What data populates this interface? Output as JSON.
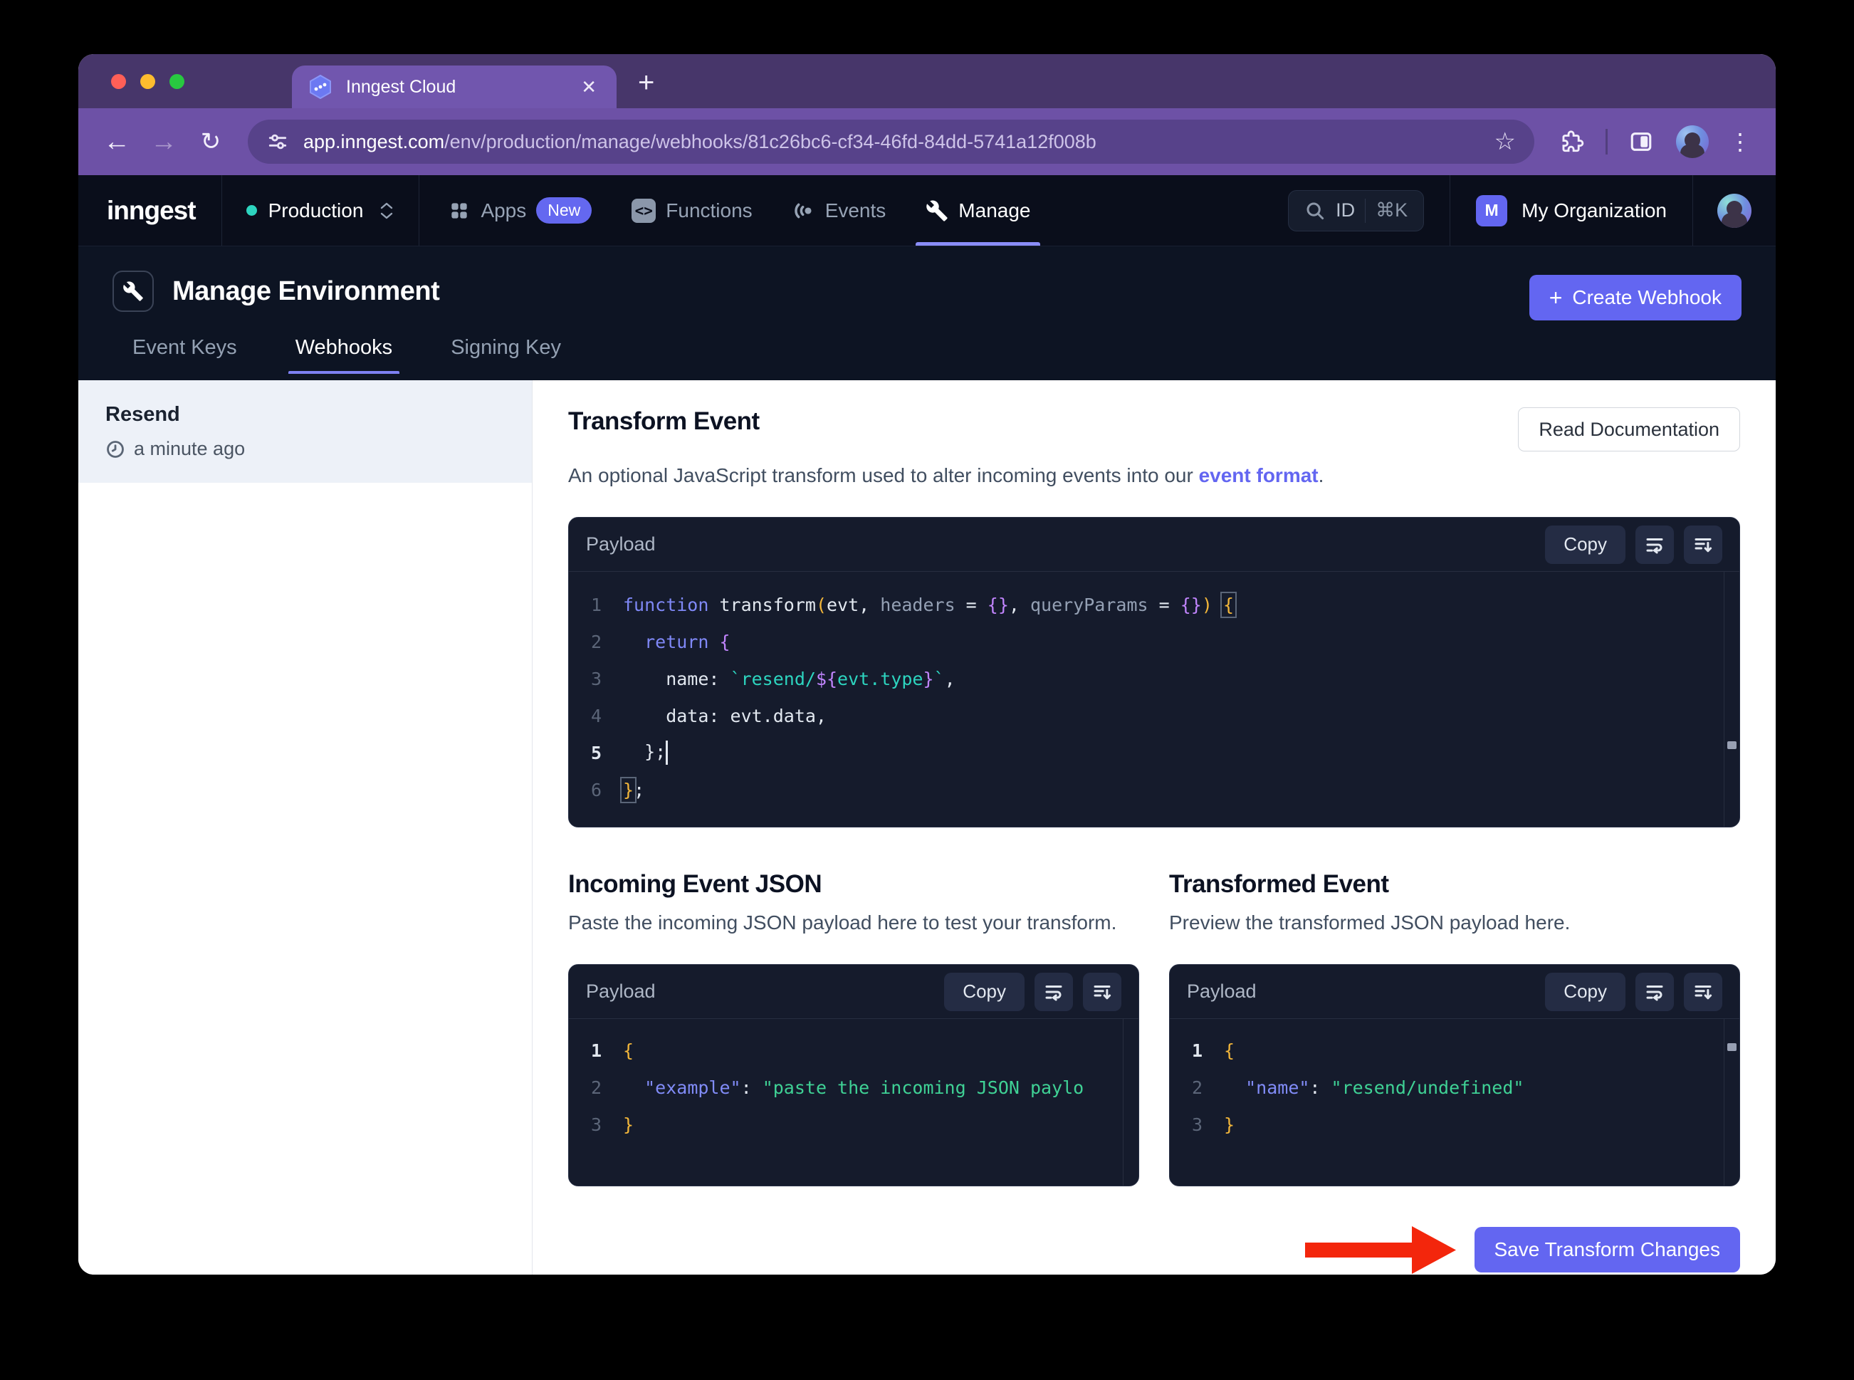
{
  "browser": {
    "tab_title": "Inngest Cloud",
    "close_glyph": "✕",
    "new_tab_glyph": "+",
    "back_glyph": "←",
    "forward_glyph": "→",
    "reload_glyph": "↻",
    "star_glyph": "☆",
    "menu_glyph": "⋮",
    "url_host": "app.inngest.com",
    "url_path": "/env/production/manage/webhooks/81c26bc6-cf34-46fd-84dd-5741a12f008b"
  },
  "nav": {
    "logo": "inngest",
    "env_name": "Production",
    "items": [
      {
        "label": "Apps",
        "badge": "New"
      },
      {
        "label": "Functions"
      },
      {
        "label": "Events"
      },
      {
        "label": "Manage"
      }
    ],
    "functions_icon_glyph": "<>",
    "search": {
      "id_label": "ID",
      "shortcut": "⌘K"
    },
    "org": {
      "initial": "M",
      "name": "My Organization"
    }
  },
  "manage_header": {
    "title": "Manage Environment",
    "create_plus": "+",
    "create_label": "Create Webhook",
    "tabs": [
      {
        "label": "Event Keys",
        "active": false
      },
      {
        "label": "Webhooks",
        "active": true
      },
      {
        "label": "Signing Key",
        "active": false
      }
    ]
  },
  "sidebar": {
    "items": [
      {
        "name": "Resend",
        "time": "a minute ago",
        "selected": true
      }
    ]
  },
  "transform": {
    "title": "Transform Event",
    "read_docs_label": "Read Documentation",
    "description_prefix": "An optional JavaScript transform used to alter incoming events into our ",
    "link_text": "event format",
    "description_suffix": "."
  },
  "editor": {
    "label": "Payload",
    "copy_label": "Copy",
    "lines": [
      {
        "n": "1",
        "active": false,
        "segs": [
          {
            "c": "kw",
            "t": "function"
          },
          {
            "c": "plain",
            "t": " transform"
          },
          {
            "c": "paren",
            "t": "("
          },
          {
            "c": "plain",
            "t": "evt, "
          },
          {
            "c": "param",
            "t": "headers"
          },
          {
            "c": "plain",
            "t": " = "
          },
          {
            "c": "brace",
            "t": "{}"
          },
          {
            "c": "plain",
            "t": ", "
          },
          {
            "c": "param",
            "t": "queryParams"
          },
          {
            "c": "plain",
            "t": " = "
          },
          {
            "c": "brace",
            "t": "{}"
          },
          {
            "c": "paren",
            "t": ")"
          },
          {
            "c": "plain",
            "t": " "
          },
          {
            "c": "boxed",
            "t": "{"
          }
        ]
      },
      {
        "n": "2",
        "active": false,
        "segs": [
          {
            "c": "plain",
            "t": "  "
          },
          {
            "c": "kw",
            "t": "return"
          },
          {
            "c": "plain",
            "t": " "
          },
          {
            "c": "brace",
            "t": "{"
          }
        ]
      },
      {
        "n": "3",
        "active": false,
        "segs": [
          {
            "c": "plain",
            "t": "    name: "
          },
          {
            "c": "str",
            "t": "`resend/"
          },
          {
            "c": "brace",
            "t": "${"
          },
          {
            "c": "str",
            "t": "evt.type"
          },
          {
            "c": "brace",
            "t": "}"
          },
          {
            "c": "str",
            "t": "`"
          },
          {
            "c": "plain",
            "t": ","
          }
        ]
      },
      {
        "n": "4",
        "active": false,
        "segs": [
          {
            "c": "plain",
            "t": "    data: evt.data,"
          }
        ]
      },
      {
        "n": "5",
        "active": true,
        "segs": [
          {
            "c": "plain",
            "t": "  };"
          },
          {
            "c": "cursor",
            "t": ""
          }
        ]
      },
      {
        "n": "6",
        "active": false,
        "segs": [
          {
            "c": "boxed",
            "t": "}"
          },
          {
            "c": "plain",
            "t": ";"
          }
        ]
      }
    ]
  },
  "incoming": {
    "title": "Incoming Event JSON",
    "description": "Paste the incoming JSON payload here to test your transform.",
    "label": "Payload",
    "copy_label": "Copy",
    "lines": [
      {
        "n": "1",
        "active": true,
        "segs": [
          {
            "c": "paren",
            "t": "{"
          }
        ]
      },
      {
        "n": "2",
        "active": false,
        "segs": [
          {
            "c": "plain",
            "t": "  "
          },
          {
            "c": "key",
            "t": "\"example\""
          },
          {
            "c": "plain",
            "t": ": "
          },
          {
            "c": "val",
            "t": "\"paste the incoming JSON paylo"
          }
        ]
      },
      {
        "n": "3",
        "active": false,
        "segs": [
          {
            "c": "paren",
            "t": "}"
          }
        ]
      }
    ]
  },
  "transformed": {
    "title": "Transformed Event",
    "description": "Preview the transformed JSON payload here.",
    "label": "Payload",
    "copy_label": "Copy",
    "lines": [
      {
        "n": "1",
        "active": true,
        "segs": [
          {
            "c": "paren",
            "t": "{"
          }
        ]
      },
      {
        "n": "2",
        "active": false,
        "segs": [
          {
            "c": "plain",
            "t": "  "
          },
          {
            "c": "key",
            "t": "\"name\""
          },
          {
            "c": "plain",
            "t": ": "
          },
          {
            "c": "val",
            "t": "\"resend/undefined\""
          }
        ]
      },
      {
        "n": "3",
        "active": false,
        "segs": [
          {
            "c": "paren",
            "t": "}"
          }
        ]
      }
    ]
  },
  "save_button_label": "Save Transform Changes",
  "colors": {
    "accent_indigo": "#6366f1",
    "arrow_red": "#f3260c",
    "env_dot_teal": "#2dd4bf",
    "chrome_theme_purple": "#6d51a6",
    "dark_navy": "#0d1423",
    "editor_bg": "#151b2c"
  }
}
